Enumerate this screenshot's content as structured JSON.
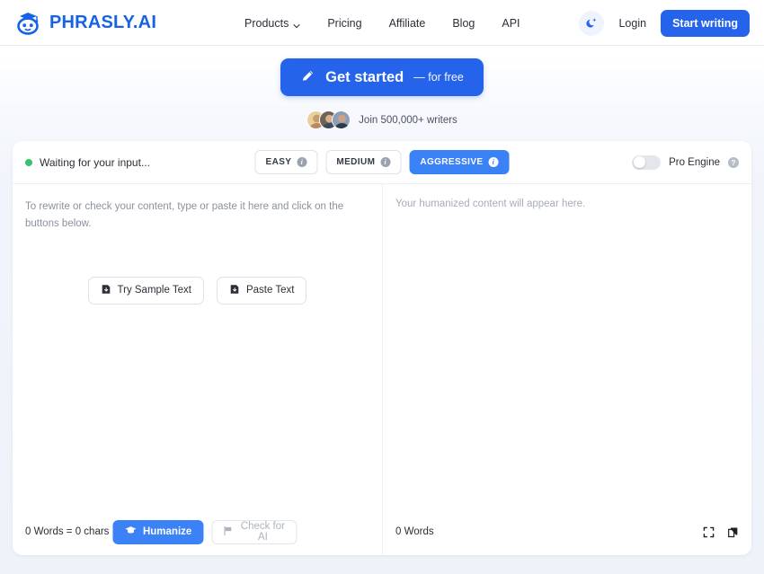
{
  "brand": {
    "name": "PHRASLY.AI",
    "logo_icon": "robot-graduate-icon",
    "color": "#1763e6"
  },
  "nav": {
    "items": [
      {
        "label": "Products",
        "has_caret": true
      },
      {
        "label": "Pricing",
        "has_caret": false
      },
      {
        "label": "Affiliate",
        "has_caret": false
      },
      {
        "label": "Blog",
        "has_caret": false
      },
      {
        "label": "API",
        "has_caret": false
      }
    ],
    "dark_mode_icon": "moon-icon",
    "login_label": "Login",
    "start_writing_label": "Start writing"
  },
  "hero": {
    "cta_icon": "pencil-icon",
    "cta_label": "Get started",
    "cta_sub": "— for free",
    "social_proof": "Join 500,000+ writers",
    "avatar_count": 3
  },
  "editor": {
    "status_text": "Waiting for your input...",
    "status_color": "#38c172",
    "modes": [
      {
        "label": "EASY",
        "active": false,
        "info_icon": "info-icon"
      },
      {
        "label": "MEDIUM",
        "active": false,
        "info_icon": "info-icon"
      },
      {
        "label": "AGGRESSIVE",
        "active": true,
        "info_icon": "info-icon"
      }
    ],
    "pro_engine": {
      "label": "Pro Engine",
      "enabled": false,
      "help_icon": "help-icon"
    },
    "input": {
      "placeholder": "To rewrite or check your content, type or paste it here and click on the buttons below.",
      "sample_button": "Try Sample Text",
      "paste_button": "Paste Text",
      "sample_icon": "import-icon",
      "paste_icon": "import-icon",
      "count": "0 Words = 0 chars",
      "humanize_label": "Humanize",
      "humanize_icon": "graduation-cap-icon",
      "check_ai_label": "Check for AI",
      "check_ai_icon": "flag-icon"
    },
    "output": {
      "placeholder": "Your humanized content will appear here.",
      "count": "0 Words",
      "expand_icon": "fullscreen-icon",
      "copy_icon": "copy-icon"
    }
  }
}
